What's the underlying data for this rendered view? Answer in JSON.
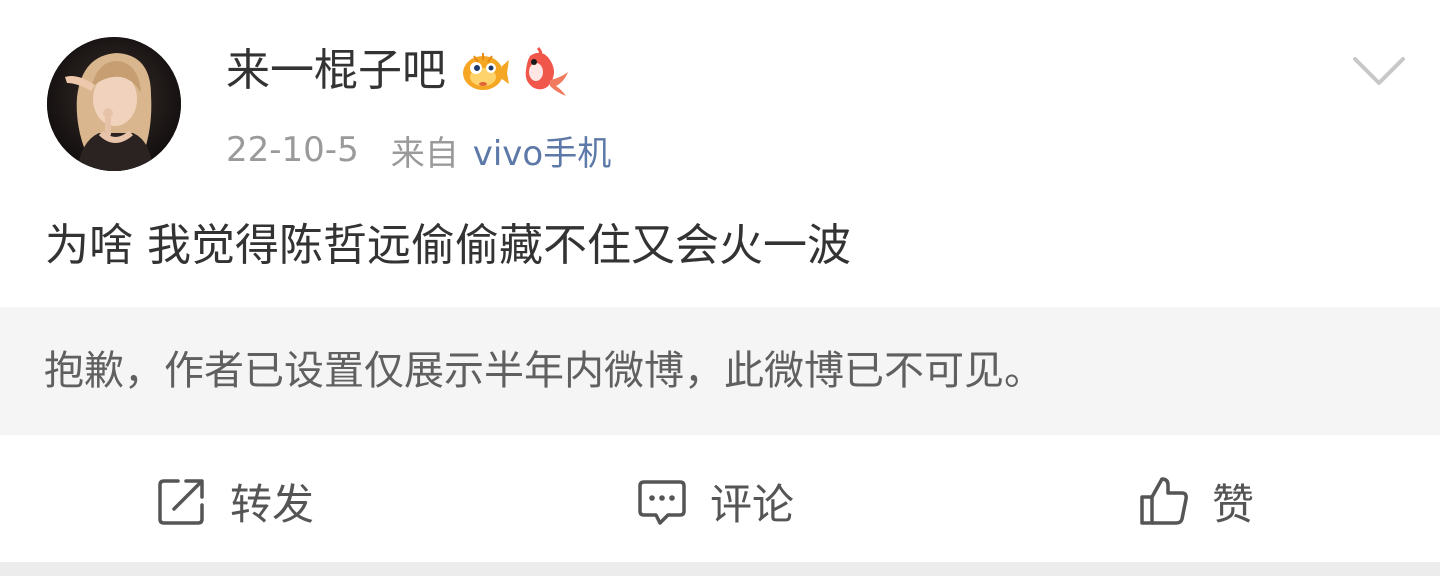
{
  "post": {
    "username": "来一棍子吧",
    "badges": [
      "pufferfish-badge-icon",
      "koi-badge-icon"
    ],
    "date": "22-10-5",
    "from_label": "来自",
    "source": "vivo手机",
    "text": "为啥 我觉得陈哲远偷偷藏不住又会火一波",
    "notice": "抱歉，作者已设置仅展示半年内微博，此微博已不可见。"
  },
  "actions": {
    "repost_label": "转发",
    "comment_label": "评论",
    "like_label": "赞"
  },
  "colors": {
    "source_link": "#5d79a8",
    "meta_gray": "#9a9a9a",
    "notice_bg": "#f5f5f5",
    "text": "#333333"
  }
}
